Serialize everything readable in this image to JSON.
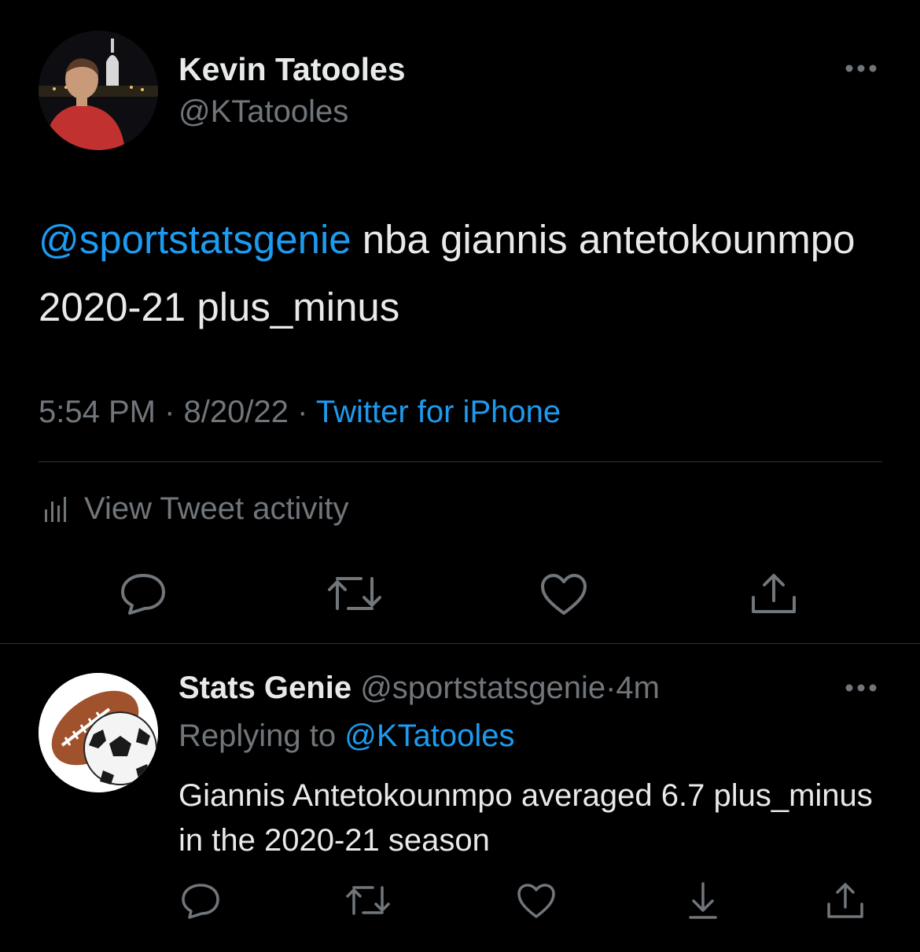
{
  "colors": {
    "background": "#000000",
    "text": "#e7e9ea",
    "muted": "#71767b",
    "accent": "#1d9bf0",
    "divider": "#2f3336"
  },
  "tweet": {
    "author_name": "Kevin Tatooles",
    "author_handle": "@KTatooles",
    "text_mention": "@sportstatsgenie",
    "text_rest": " nba giannis antetokounmpo 2020-21 plus_minus",
    "time": "5:54 PM",
    "date": "8/20/22",
    "separator": "·",
    "source": "Twitter for iPhone",
    "activity_label": "View Tweet activity",
    "icons": [
      "reply-icon",
      "retweet-icon",
      "like-icon",
      "share-icon"
    ]
  },
  "reply": {
    "author_name": "Stats Genie",
    "author_handle": "@sportstatsgenie",
    "age": "4m",
    "separator": "·",
    "replying_prefix": "Replying to",
    "replying_to": "@KTatooles",
    "text": "Giannis Antetokounmpo averaged 6.7 plus_minus in the 2020-21 season",
    "icons": [
      "reply-icon",
      "retweet-icon",
      "like-icon",
      "download-icon",
      "share-icon"
    ]
  }
}
